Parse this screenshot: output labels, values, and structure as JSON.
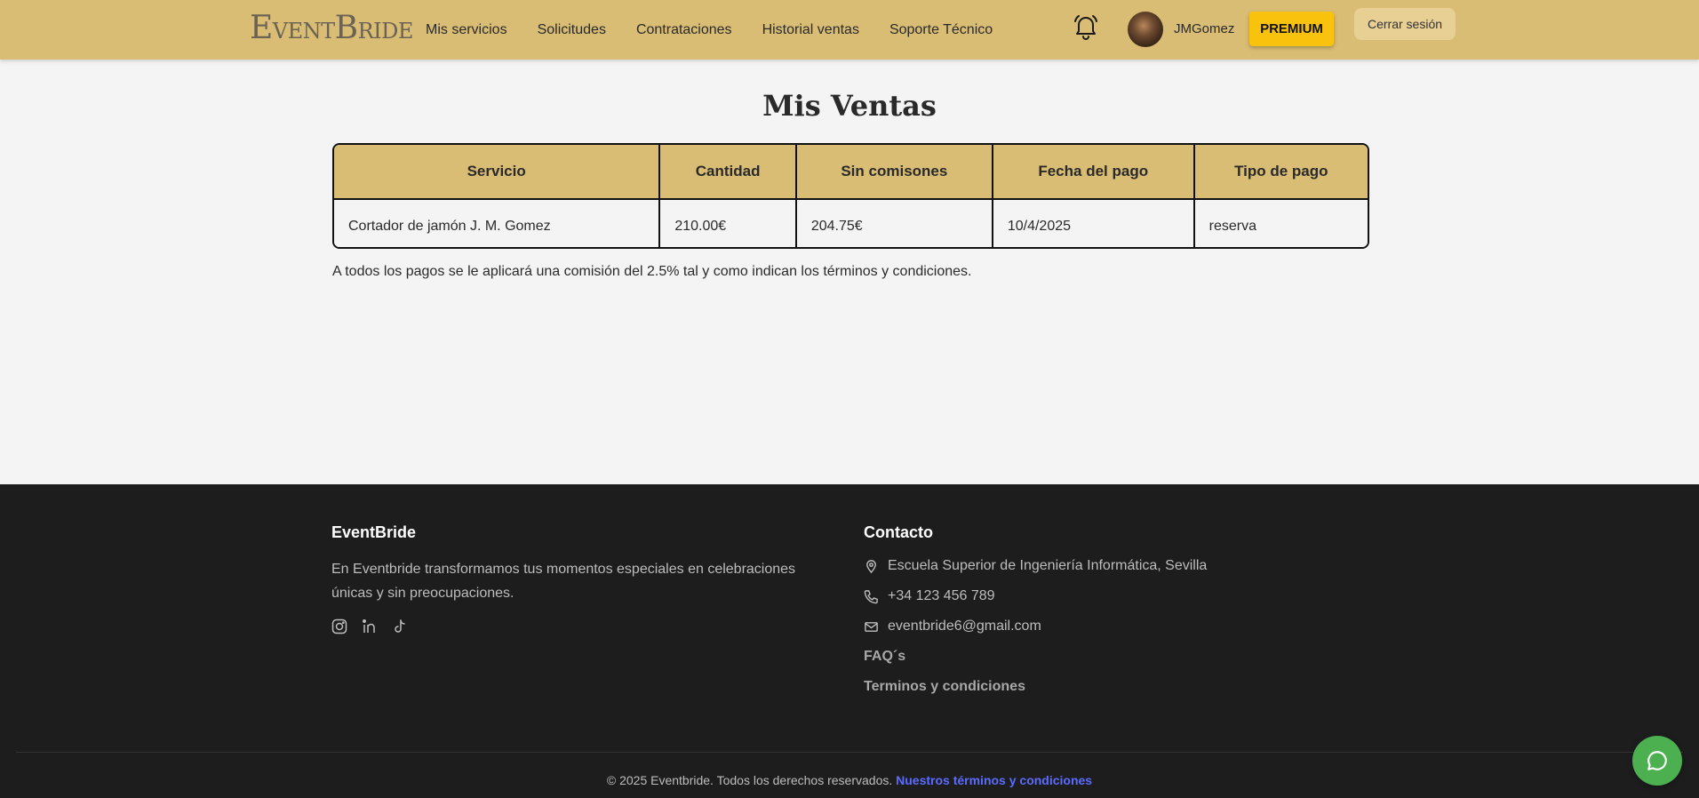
{
  "header": {
    "logo": {
      "first_initial": "E",
      "first_rest": "VENT",
      "second_initial": "B",
      "second_rest": "RIDE"
    },
    "nav": [
      "Mis servicios",
      "Solicitudes",
      "Contrataciones",
      "Historial ventas",
      "Soporte Técnico"
    ],
    "bell_icon": "bell-icon",
    "username": "JMGomez",
    "premium_label": "PREMIUM",
    "logout_label": "Cerrar sesión",
    "colors": {
      "bar": "#d9bd74",
      "premium": "#f9c20c"
    }
  },
  "main": {
    "title": "Mis Ventas",
    "table": {
      "headers": [
        "Servicio",
        "Cantidad",
        "Sin comisones",
        "Fecha del pago",
        "Tipo de pago"
      ],
      "rows": [
        [
          "Cortador de jamón J. M. Gomez",
          "210.00€",
          "204.75€",
          "10/4/2025",
          "reserva"
        ]
      ]
    },
    "note": "A todos los pagos se le aplicará una comisión del 2.5% tal y como indican los términos y condiciones."
  },
  "footer": {
    "brand_title": "EventBride",
    "description": "En Eventbride transformamos tus momentos especiales en celebraciones únicas y sin preocupaciones.",
    "social_icons": [
      "instagram-icon",
      "linkedin-icon",
      "tiktok-icon"
    ],
    "contact_title": "Contacto",
    "address": "Escuela Superior de Ingeniería Informática, Sevilla",
    "phone": "+34 123 456 789",
    "email": "eventbride6@gmail.com",
    "faq": "FAQ´s",
    "terms": "Terminos y condiciones",
    "copyright": "© 2025 Eventbride. Todos los derechos reservados.",
    "copyright_link": "Nuestros términos y condiciones"
  },
  "chat_icon": "chat-bubble-icon"
}
